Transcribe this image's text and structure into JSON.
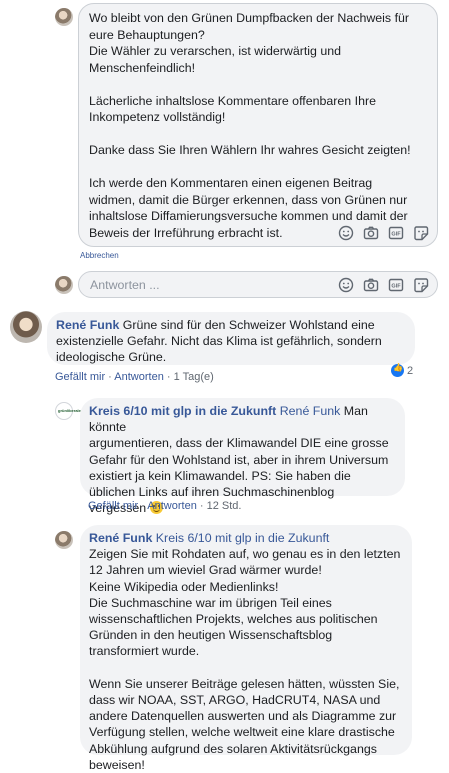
{
  "edit_comment": {
    "text": "Wo bleibt von den Grünen Dumpfbacken der Nachweis für\neure Behauptungen?\nDie Wähler zu verarschen, ist widerwärtig und\nMenschenfeindlich!\n\nLächerliche inhaltslose Kommentare offenbaren Ihre\nInkompetenz vollständig!\n\nDanke dass Sie Ihren Wählern Ihr wahres Gesicht zeigten!\n\nIch werde den Kommentaren einen eigenen Beitrag\nwidmen, damit die Bürger erkennen, dass von Grünen nur\ninhaltslose Diffamierungsversuche kommen und damit der\nBeweis der Irreführung erbracht ist.",
    "cancel_label": "Abbrechen"
  },
  "reply_box": {
    "placeholder": "Antworten ..."
  },
  "icons": [
    "emoji-icon",
    "camera-icon",
    "gif-icon",
    "sticker-icon"
  ],
  "comments": [
    {
      "author": "René Funk",
      "text": " Grüne sind für den Schweizer Wohlstand eine\nexistenzielle Gefahr. Nicht das Klima ist gefährlich, sondern\nideologische Grüne.",
      "like_label": "Gefällt mir",
      "reply_label": "Antworten",
      "time": "1 Tag(e)",
      "reactions": "2"
    },
    {
      "author": "Kreis 6/10 mit glp in die Zukunft",
      "tag": "René Funk",
      "text_line1": " Man könnte",
      "text_rest": "argumentieren, dass der Klimawandel DIE eine grosse\nGefahr für den Wohlstand ist, aber in ihrem Universum\nexistiert ja kein Klimawandel. PS: Sie haben die\nüblichen Links auf ihren Suchmaschinenblog\nvergessen ",
      "avatar_logo_text": "grünliberale",
      "like_label": "Gefällt mir",
      "reply_label": "Antworten",
      "time": "12 Std."
    },
    {
      "author": "René Funk",
      "tag": "Kreis 6/10 mit glp in die Zukunft",
      "text": "Zeigen Sie mit Rohdaten auf, wo genau es in den letzten\n12 Jahren um wieviel Grad wärmer wurde!\nKeine Wikipedia oder Medienlinks!\nDie Suchmaschine war im übrigen Teil eines\nwissenschaftlichen Projekts, welches aus politischen\nGründen in den heutigen Wissenschaftsblog\ntransformiert wurde.\n\nWenn Sie unserer Beiträge gelesen hätten, wüssten Sie,\ndass wir NOAA, SST, ARGO, HadCRUT4, NASA und\nandere Datenquellen auswerten und als Diagramme zur\nVerfügung stellen, welche weltweit eine klare drastische\nAbkühlung aufgrund des solaren Aktivitätsrückgangs\nbeweisen!"
    }
  ]
}
